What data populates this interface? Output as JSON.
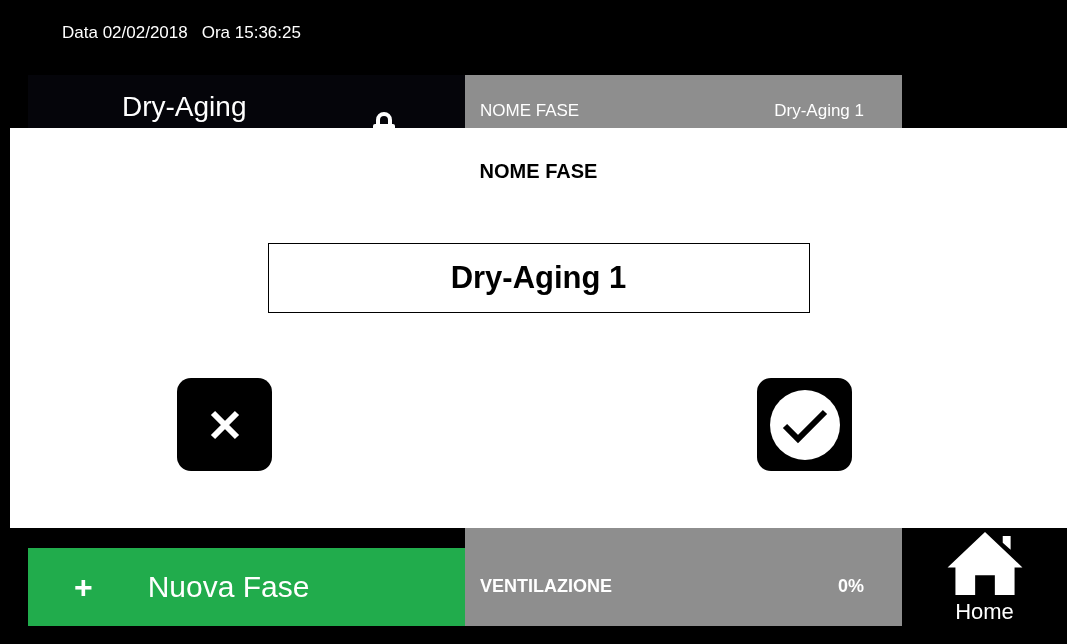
{
  "status_bar": {
    "date_label": "Data 02/02/2018",
    "time_label": "Ora 15:36:25"
  },
  "header": {
    "program_name": "Dry-Aging",
    "locked": true,
    "phase_label": "NOME FASE",
    "phase_value": "Dry-Aging 1"
  },
  "dialog": {
    "title": "NOME FASE",
    "value": "Dry-Aging 1"
  },
  "footer": {
    "add_icon": "+",
    "add_label": "Nuova Fase",
    "param_label": "VENTILAZIONE",
    "param_value": "0%",
    "home_label": "Home"
  }
}
